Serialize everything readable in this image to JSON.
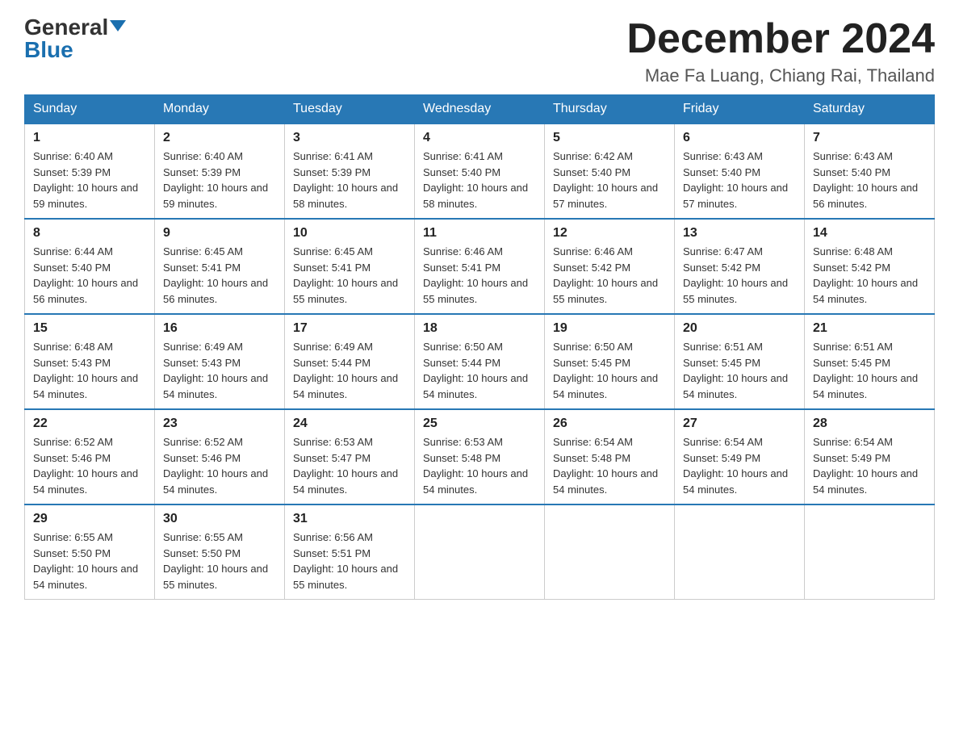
{
  "header": {
    "logo_general": "General",
    "logo_blue": "Blue",
    "month_title": "December 2024",
    "location": "Mae Fa Luang, Chiang Rai, Thailand"
  },
  "days_of_week": [
    "Sunday",
    "Monday",
    "Tuesday",
    "Wednesday",
    "Thursday",
    "Friday",
    "Saturday"
  ],
  "weeks": [
    [
      {
        "day": "1",
        "sunrise": "6:40 AM",
        "sunset": "5:39 PM",
        "daylight": "10 hours and 59 minutes."
      },
      {
        "day": "2",
        "sunrise": "6:40 AM",
        "sunset": "5:39 PM",
        "daylight": "10 hours and 59 minutes."
      },
      {
        "day": "3",
        "sunrise": "6:41 AM",
        "sunset": "5:39 PM",
        "daylight": "10 hours and 58 minutes."
      },
      {
        "day": "4",
        "sunrise": "6:41 AM",
        "sunset": "5:40 PM",
        "daylight": "10 hours and 58 minutes."
      },
      {
        "day": "5",
        "sunrise": "6:42 AM",
        "sunset": "5:40 PM",
        "daylight": "10 hours and 57 minutes."
      },
      {
        "day": "6",
        "sunrise": "6:43 AM",
        "sunset": "5:40 PM",
        "daylight": "10 hours and 57 minutes."
      },
      {
        "day": "7",
        "sunrise": "6:43 AM",
        "sunset": "5:40 PM",
        "daylight": "10 hours and 56 minutes."
      }
    ],
    [
      {
        "day": "8",
        "sunrise": "6:44 AM",
        "sunset": "5:40 PM",
        "daylight": "10 hours and 56 minutes."
      },
      {
        "day": "9",
        "sunrise": "6:45 AM",
        "sunset": "5:41 PM",
        "daylight": "10 hours and 56 minutes."
      },
      {
        "day": "10",
        "sunrise": "6:45 AM",
        "sunset": "5:41 PM",
        "daylight": "10 hours and 55 minutes."
      },
      {
        "day": "11",
        "sunrise": "6:46 AM",
        "sunset": "5:41 PM",
        "daylight": "10 hours and 55 minutes."
      },
      {
        "day": "12",
        "sunrise": "6:46 AM",
        "sunset": "5:42 PM",
        "daylight": "10 hours and 55 minutes."
      },
      {
        "day": "13",
        "sunrise": "6:47 AM",
        "sunset": "5:42 PM",
        "daylight": "10 hours and 55 minutes."
      },
      {
        "day": "14",
        "sunrise": "6:48 AM",
        "sunset": "5:42 PM",
        "daylight": "10 hours and 54 minutes."
      }
    ],
    [
      {
        "day": "15",
        "sunrise": "6:48 AM",
        "sunset": "5:43 PM",
        "daylight": "10 hours and 54 minutes."
      },
      {
        "day": "16",
        "sunrise": "6:49 AM",
        "sunset": "5:43 PM",
        "daylight": "10 hours and 54 minutes."
      },
      {
        "day": "17",
        "sunrise": "6:49 AM",
        "sunset": "5:44 PM",
        "daylight": "10 hours and 54 minutes."
      },
      {
        "day": "18",
        "sunrise": "6:50 AM",
        "sunset": "5:44 PM",
        "daylight": "10 hours and 54 minutes."
      },
      {
        "day": "19",
        "sunrise": "6:50 AM",
        "sunset": "5:45 PM",
        "daylight": "10 hours and 54 minutes."
      },
      {
        "day": "20",
        "sunrise": "6:51 AM",
        "sunset": "5:45 PM",
        "daylight": "10 hours and 54 minutes."
      },
      {
        "day": "21",
        "sunrise": "6:51 AM",
        "sunset": "5:45 PM",
        "daylight": "10 hours and 54 minutes."
      }
    ],
    [
      {
        "day": "22",
        "sunrise": "6:52 AM",
        "sunset": "5:46 PM",
        "daylight": "10 hours and 54 minutes."
      },
      {
        "day": "23",
        "sunrise": "6:52 AM",
        "sunset": "5:46 PM",
        "daylight": "10 hours and 54 minutes."
      },
      {
        "day": "24",
        "sunrise": "6:53 AM",
        "sunset": "5:47 PM",
        "daylight": "10 hours and 54 minutes."
      },
      {
        "day": "25",
        "sunrise": "6:53 AM",
        "sunset": "5:48 PM",
        "daylight": "10 hours and 54 minutes."
      },
      {
        "day": "26",
        "sunrise": "6:54 AM",
        "sunset": "5:48 PM",
        "daylight": "10 hours and 54 minutes."
      },
      {
        "day": "27",
        "sunrise": "6:54 AM",
        "sunset": "5:49 PM",
        "daylight": "10 hours and 54 minutes."
      },
      {
        "day": "28",
        "sunrise": "6:54 AM",
        "sunset": "5:49 PM",
        "daylight": "10 hours and 54 minutes."
      }
    ],
    [
      {
        "day": "29",
        "sunrise": "6:55 AM",
        "sunset": "5:50 PM",
        "daylight": "10 hours and 54 minutes."
      },
      {
        "day": "30",
        "sunrise": "6:55 AM",
        "sunset": "5:50 PM",
        "daylight": "10 hours and 55 minutes."
      },
      {
        "day": "31",
        "sunrise": "6:56 AM",
        "sunset": "5:51 PM",
        "daylight": "10 hours and 55 minutes."
      },
      null,
      null,
      null,
      null
    ]
  ]
}
